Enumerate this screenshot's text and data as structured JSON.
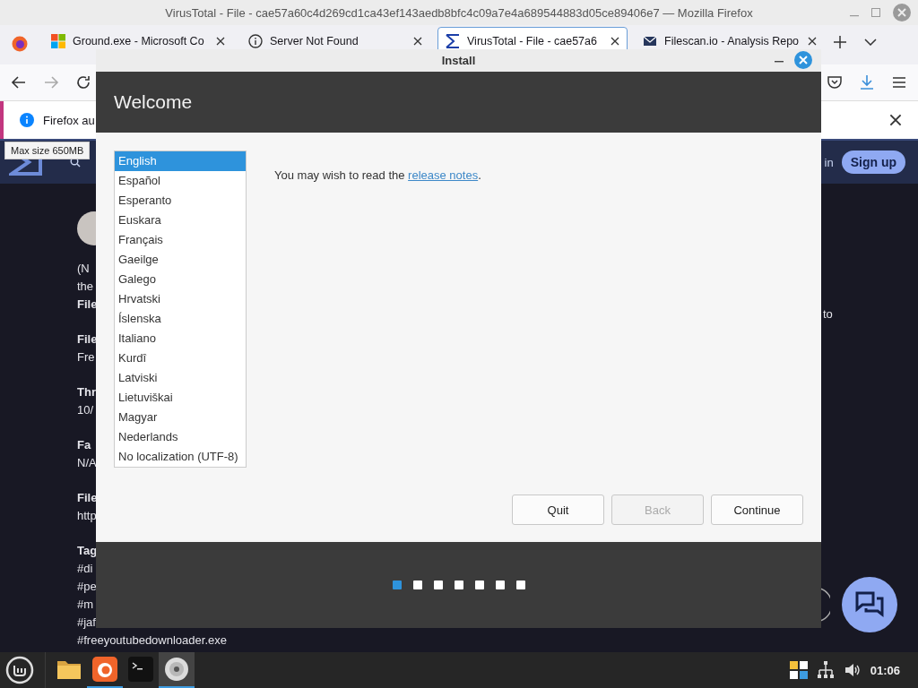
{
  "browser": {
    "title": "VirusTotal - File - cae57a60c4d269cd1ca43ef143aedb8bfc4c09a7e4a689544883d05ce89406e7 — Mozilla Firefox",
    "tabs": [
      {
        "label": "Ground.exe - Microsoft Co",
        "kind": "windows",
        "selected": false
      },
      {
        "label": "Server Not Found",
        "kind": "info",
        "selected": false
      },
      {
        "label": "VirusTotal - File - cae57a6",
        "kind": "virustotal",
        "selected": true
      },
      {
        "label": "Filescan.io - Analysis Repo",
        "kind": "mail",
        "selected": false
      }
    ],
    "notification": "Firefox au",
    "tooltip": "Max size 650MB",
    "page": {
      "sign_in": "in",
      "sign_up": "Sign up",
      "right_text": "to",
      "paragraphs": [
        [
          {
            "text": "(N",
            "bold": false
          },
          {
            "text": "the",
            "bold": false
          },
          {
            "text": "File",
            "bold": true
          }
        ],
        [
          {
            "text": "File",
            "bold": true
          },
          {
            "text": "Fre",
            "bold": false
          }
        ],
        [
          {
            "text": "Thr",
            "bold": true
          },
          {
            "text": "10/",
            "bold": false
          }
        ],
        [
          {
            "text": "Fa",
            "bold": true
          },
          {
            "text": "N/A",
            "bold": false
          }
        ],
        [
          {
            "text": "File",
            "bold": true
          },
          {
            "text": "http",
            "bold": false
          }
        ],
        [
          {
            "text": "Tag",
            "bold": true
          },
          {
            "text": "#di",
            "bold": false
          },
          {
            "text": "#pe",
            "bold": false
          },
          {
            "text": "#m",
            "bold": false
          },
          {
            "text": "#jaf",
            "bold": false
          },
          {
            "text": "#freeyoutubedownloader.exe",
            "bold": false
          }
        ]
      ]
    }
  },
  "installer": {
    "title": "Install",
    "heading": "Welcome",
    "languages": [
      {
        "name": "English",
        "selected": true
      },
      {
        "name": "Español",
        "selected": false
      },
      {
        "name": "Esperanto",
        "selected": false
      },
      {
        "name": "Euskara",
        "selected": false
      },
      {
        "name": "Français",
        "selected": false
      },
      {
        "name": "Gaeilge",
        "selected": false
      },
      {
        "name": "Galego",
        "selected": false
      },
      {
        "name": "Hrvatski",
        "selected": false
      },
      {
        "name": "Íslenska",
        "selected": false
      },
      {
        "name": "Italiano",
        "selected": false
      },
      {
        "name": "Kurdî",
        "selected": false
      },
      {
        "name": "Latviski",
        "selected": false
      },
      {
        "name": "Lietuviškai",
        "selected": false
      },
      {
        "name": "Magyar",
        "selected": false
      },
      {
        "name": "Nederlands",
        "selected": false
      },
      {
        "name": "No localization (UTF-8)",
        "selected": false
      }
    ],
    "notes": {
      "prefix": "You may wish to read the ",
      "link": "release notes",
      "suffix": "."
    },
    "buttons": [
      {
        "label": "Quit",
        "disabled": false
      },
      {
        "label": "Back",
        "disabled": true
      },
      {
        "label": "Continue",
        "disabled": false
      }
    ],
    "steps": [
      {
        "selected": true
      },
      {
        "selected": false
      },
      {
        "selected": false
      },
      {
        "selected": false
      },
      {
        "selected": false
      },
      {
        "selected": false
      },
      {
        "selected": false
      }
    ]
  },
  "taskbar": {
    "apps": [
      {
        "kind": "folder",
        "active": false
      },
      {
        "kind": "firefox",
        "active": true
      },
      {
        "kind": "terminal",
        "active": false
      },
      {
        "kind": "disc",
        "active": true
      }
    ],
    "clock": "01:06"
  }
}
